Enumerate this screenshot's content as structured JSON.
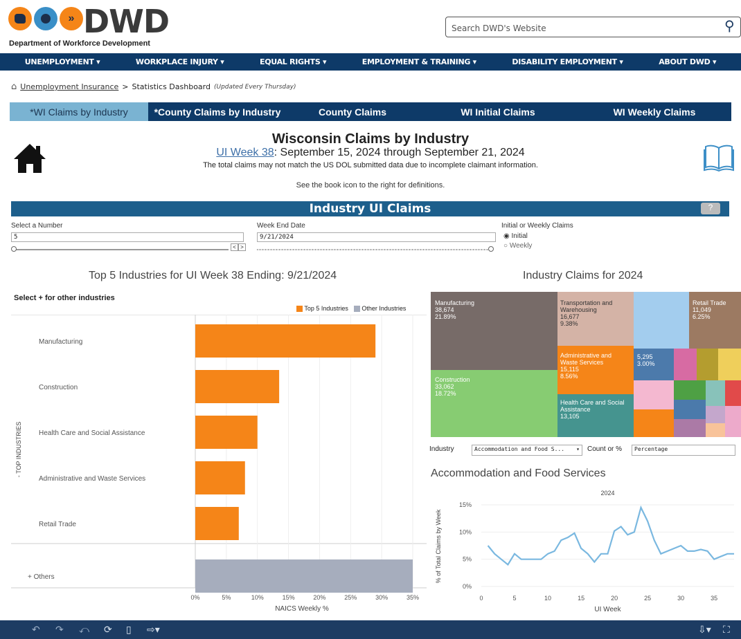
{
  "header": {
    "logo_text": "DWD",
    "logo_subtitle": "Department of Workforce Development",
    "search_placeholder": "Search DWD's Website"
  },
  "nav": [
    "UNEMPLOYMENT ▾",
    "WORKPLACE INJURY ▾",
    "EQUAL RIGHTS ▾",
    "EMPLOYMENT & TRAINING ▾",
    "DISABILITY EMPLOYMENT ▾",
    "ABOUT DWD ▾"
  ],
  "breadcrumb": {
    "link": "Unemployment Insurance",
    "separator": ">",
    "current": "Statistics Dashboard",
    "note": "(Updated Every Thursday)"
  },
  "tabs": [
    "*WI Claims by Industry",
    "*County Claims by Industry",
    "County Claims",
    "WI Initial Claims",
    "WI Weekly Claims"
  ],
  "title": {
    "main": "Wisconsin Claims by Industry",
    "week_link": "UI Week 38",
    "week_range": ": September 15, 2024 through September 21, 2024",
    "note": "The total claims may not match the US DOL submitted data due to incomplete claimant information.",
    "book_note": "See the book icon to the right for definitions."
  },
  "section_title": "Industry UI Claims",
  "help_icon": "?",
  "filters": {
    "number_label": "Select a Number",
    "number_value": "5",
    "date_label": "Week End Date",
    "date_value": "9/21/2024",
    "claims_label": "Initial or Weekly Claims",
    "options": [
      "Initial",
      "Weekly"
    ],
    "selected": "Initial"
  },
  "bar_chart_header": {
    "title": "Top 5 Industries for UI Week 38 Ending: 9/21/2024",
    "select_note": "Select + for other industries",
    "legend": [
      "Top 5 Industries",
      "Other Industries"
    ],
    "colors": {
      "top": "#f58518",
      "other": "#a6adbd"
    }
  },
  "treemap_title": "Industry Claims for 2024",
  "treemap_labels": [
    {
      "name": "Manufacturing",
      "count": "38,674",
      "pct": "21.89%"
    },
    {
      "name": "Transportation and Warehousing",
      "count": "16,677",
      "pct": "9.38%"
    },
    {
      "name": "Retail Trade",
      "count": "11,049",
      "pct": "6.25%"
    },
    {
      "name": "Administrative and Waste Services",
      "count": "15,115",
      "pct": "8.56%"
    },
    {
      "name": "",
      "count": "5,295",
      "pct": "3.00%"
    },
    {
      "name": "Construction",
      "count": "33,062",
      "pct": "18.72%"
    },
    {
      "name": "Health Care and Social Assistance",
      "count": "13,105",
      "pct": ""
    }
  ],
  "line_controls": {
    "industry_label": "Industry",
    "industry_value": "Accommodation and Food S...",
    "count_label": "Count or %",
    "count_value": "Percentage"
  },
  "line_title": "Accommodation and Food Services",
  "chart_data": [
    {
      "type": "bar",
      "categories": [
        "Manufacturing",
        "Construction",
        "Health Care and Social Assistance",
        "Administrative and Waste Services",
        "Retail Trade",
        "Others"
      ],
      "values": [
        29,
        13.5,
        10,
        8,
        7,
        35
      ],
      "series_group": [
        "Top 5 Industries",
        "Top 5 Industries",
        "Top 5 Industries",
        "Top 5 Industries",
        "Top 5 Industries",
        "Other Industries"
      ],
      "xlabel": "NAICS Weekly %",
      "ylabel": "- TOP INDUSTRIES",
      "xticks": [
        "0%",
        "5%",
        "10%",
        "15%",
        "20%",
        "25%",
        "30%",
        "35%"
      ],
      "xlim": [
        0,
        35
      ]
    },
    {
      "type": "line",
      "title": "2024",
      "xlabel": "UI Week",
      "ylabel": "% of Total Claims by Week",
      "x": [
        1,
        2,
        3,
        4,
        5,
        6,
        7,
        8,
        9,
        10,
        11,
        12,
        13,
        14,
        15,
        16,
        17,
        18,
        19,
        20,
        21,
        22,
        23,
        24,
        25,
        26,
        27,
        28,
        29,
        30,
        31,
        32,
        33,
        34,
        35,
        36,
        37,
        38
      ],
      "values": [
        7.5,
        6,
        5,
        4,
        6,
        5,
        5,
        5,
        5,
        6,
        6.5,
        8.5,
        9,
        9.8,
        7,
        6,
        4.5,
        6,
        6,
        10.2,
        11,
        9.5,
        10,
        14.5,
        12,
        8.5,
        6,
        6.5,
        7,
        7.5,
        6.5,
        6.5,
        6.8,
        6.5,
        5,
        5.5,
        6,
        6
      ],
      "yticks": [
        "0%",
        "5%",
        "10%",
        "15%"
      ],
      "xticks": [
        "0",
        "5",
        "10",
        "15",
        "20",
        "25",
        "30",
        "35"
      ],
      "ylim": [
        0,
        15
      ],
      "xlim": [
        0,
        38
      ],
      "color": "#7ab8e0"
    }
  ]
}
